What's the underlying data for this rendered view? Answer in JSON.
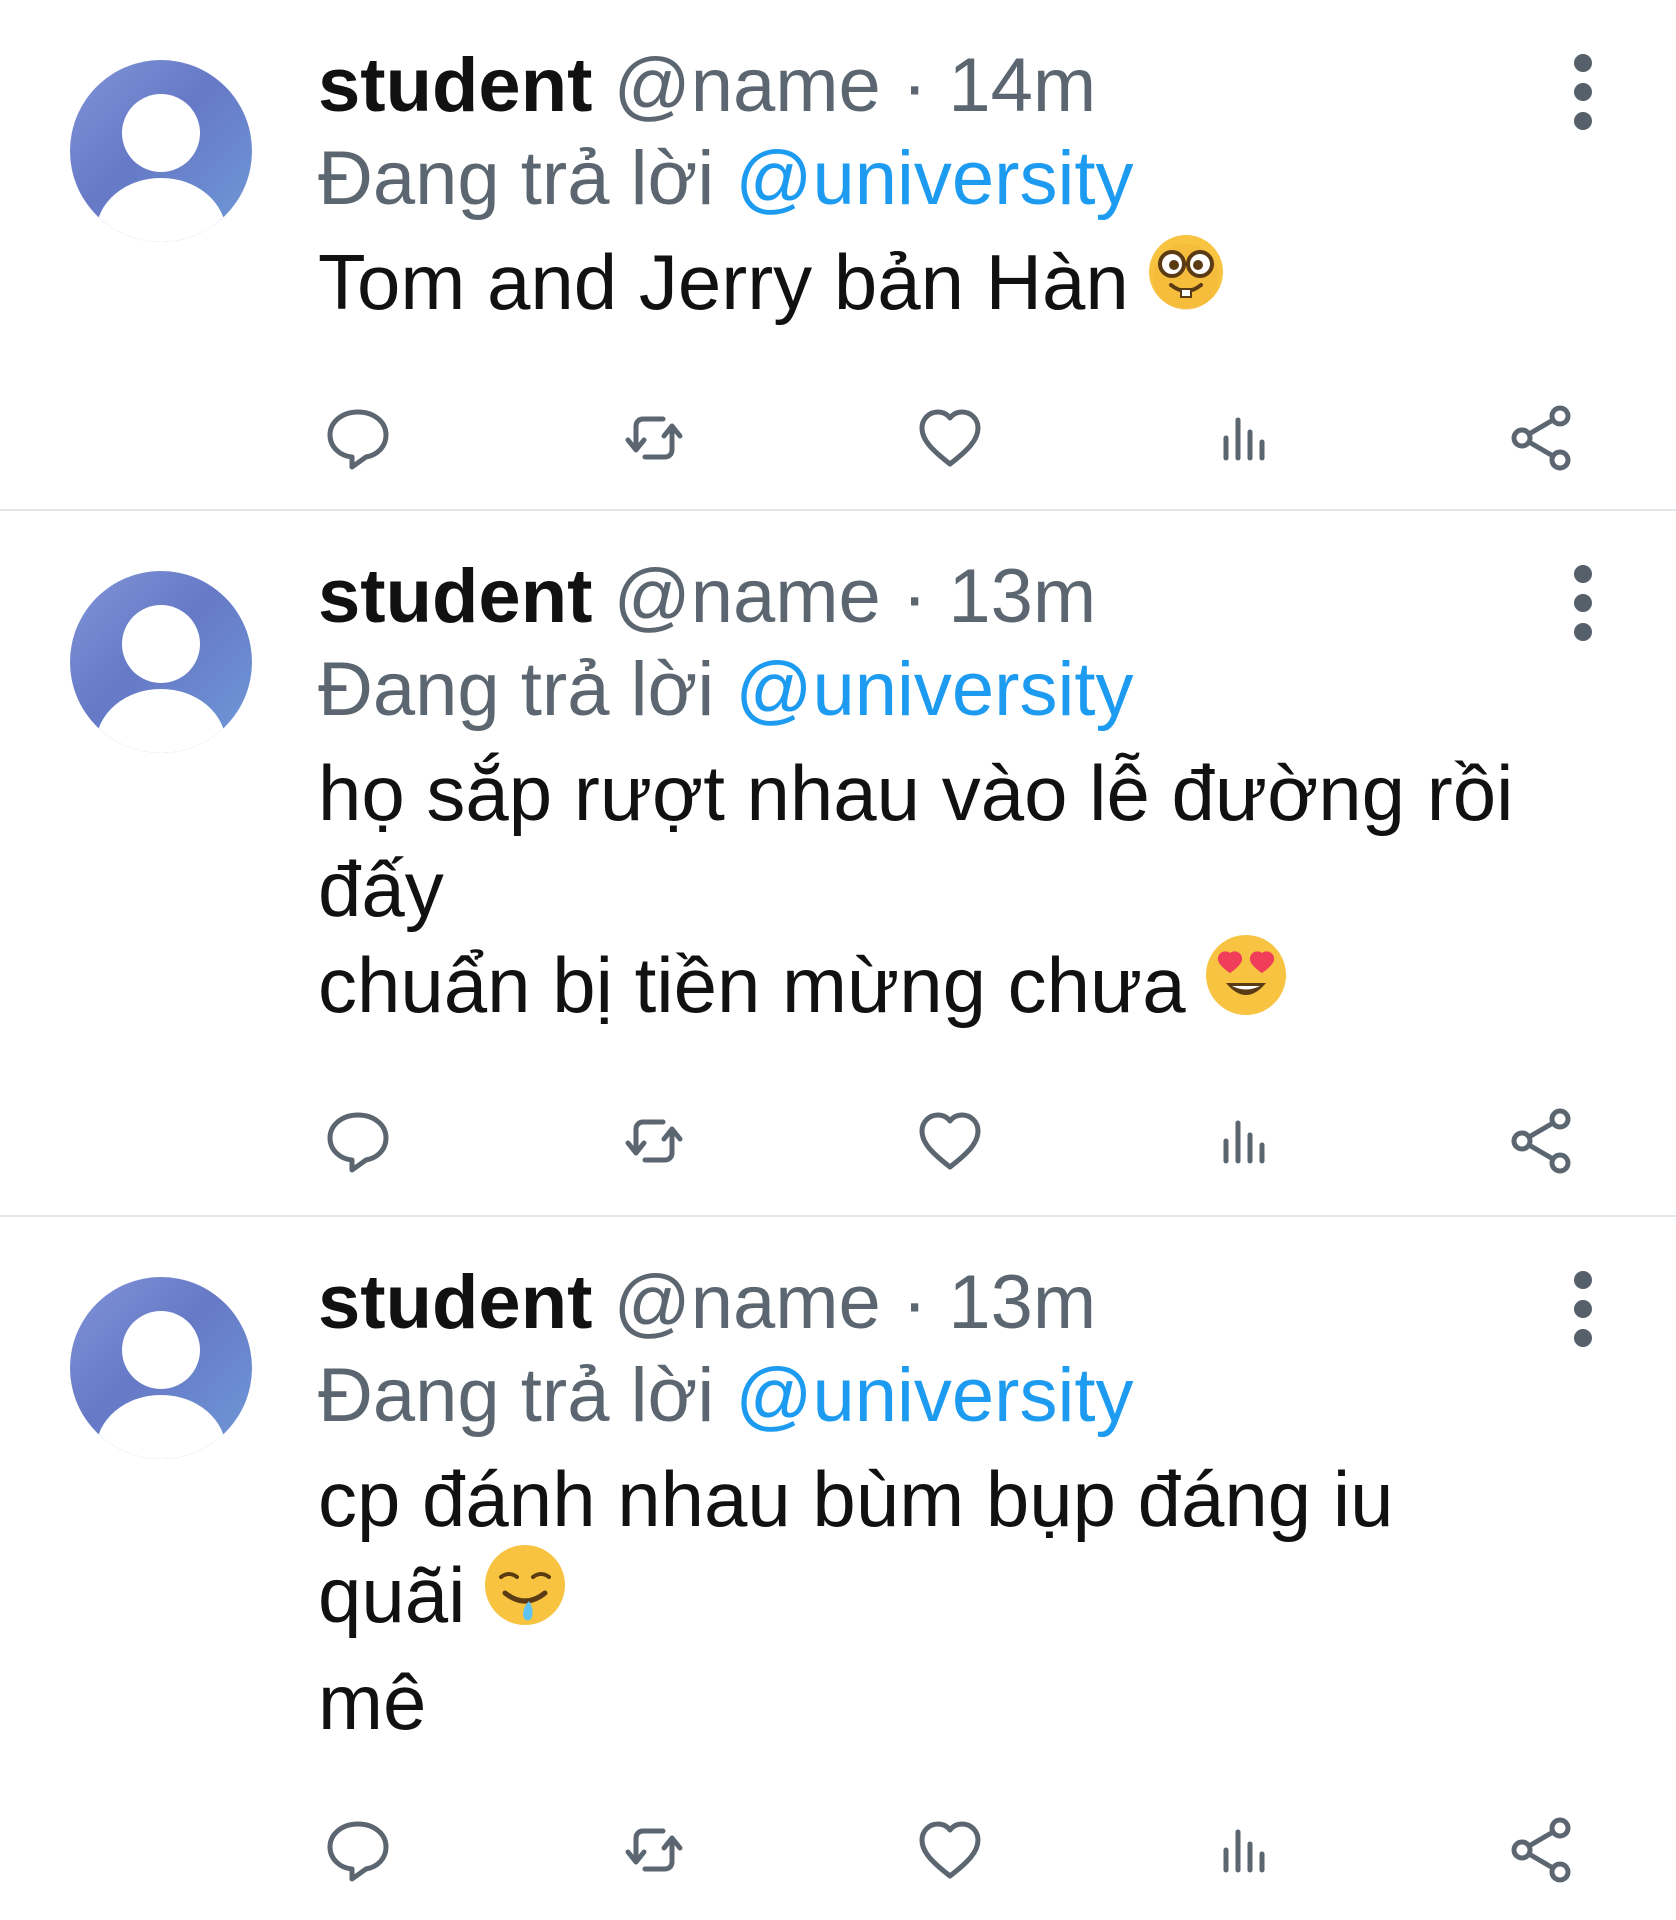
{
  "tweets": [
    {
      "username": "student",
      "handle": "@name",
      "separator": "·",
      "time": "14m",
      "reply_prefix": "Đang trả lời",
      "reply_to": "@university",
      "lines": [
        "Tom and Jerry bản Hàn"
      ],
      "emoji": "nerd-face-emoji",
      "emoji_line": 0
    },
    {
      "username": "student",
      "handle": "@name",
      "separator": "·",
      "time": "13m",
      "reply_prefix": "Đang trả lời",
      "reply_to": "@university",
      "lines": [
        "họ sắp rượt nhau vào lễ đường rồi",
        "đấy",
        "chuẩn bị tiền mừng chưa"
      ],
      "emoji": "heart-eyes-emoji",
      "emoji_line": 2
    },
    {
      "username": "student",
      "handle": "@name",
      "separator": "·",
      "time": "13m",
      "reply_prefix": "Đang trả lời",
      "reply_to": "@university",
      "lines": [
        "cp đánh nhau bùm bụp đáng iu",
        "quãi",
        "mê"
      ],
      "emoji": "drooling-face-emoji",
      "emoji_line": 1
    }
  ],
  "actions": [
    "reply-icon",
    "retweet-icon",
    "like-icon",
    "stats-icon",
    "share-icon"
  ],
  "colors": {
    "mention": "#1d9bf0",
    "secondary_text": "#5b6670",
    "icon": "#5b6670",
    "divider": "#e4e7ea"
  }
}
